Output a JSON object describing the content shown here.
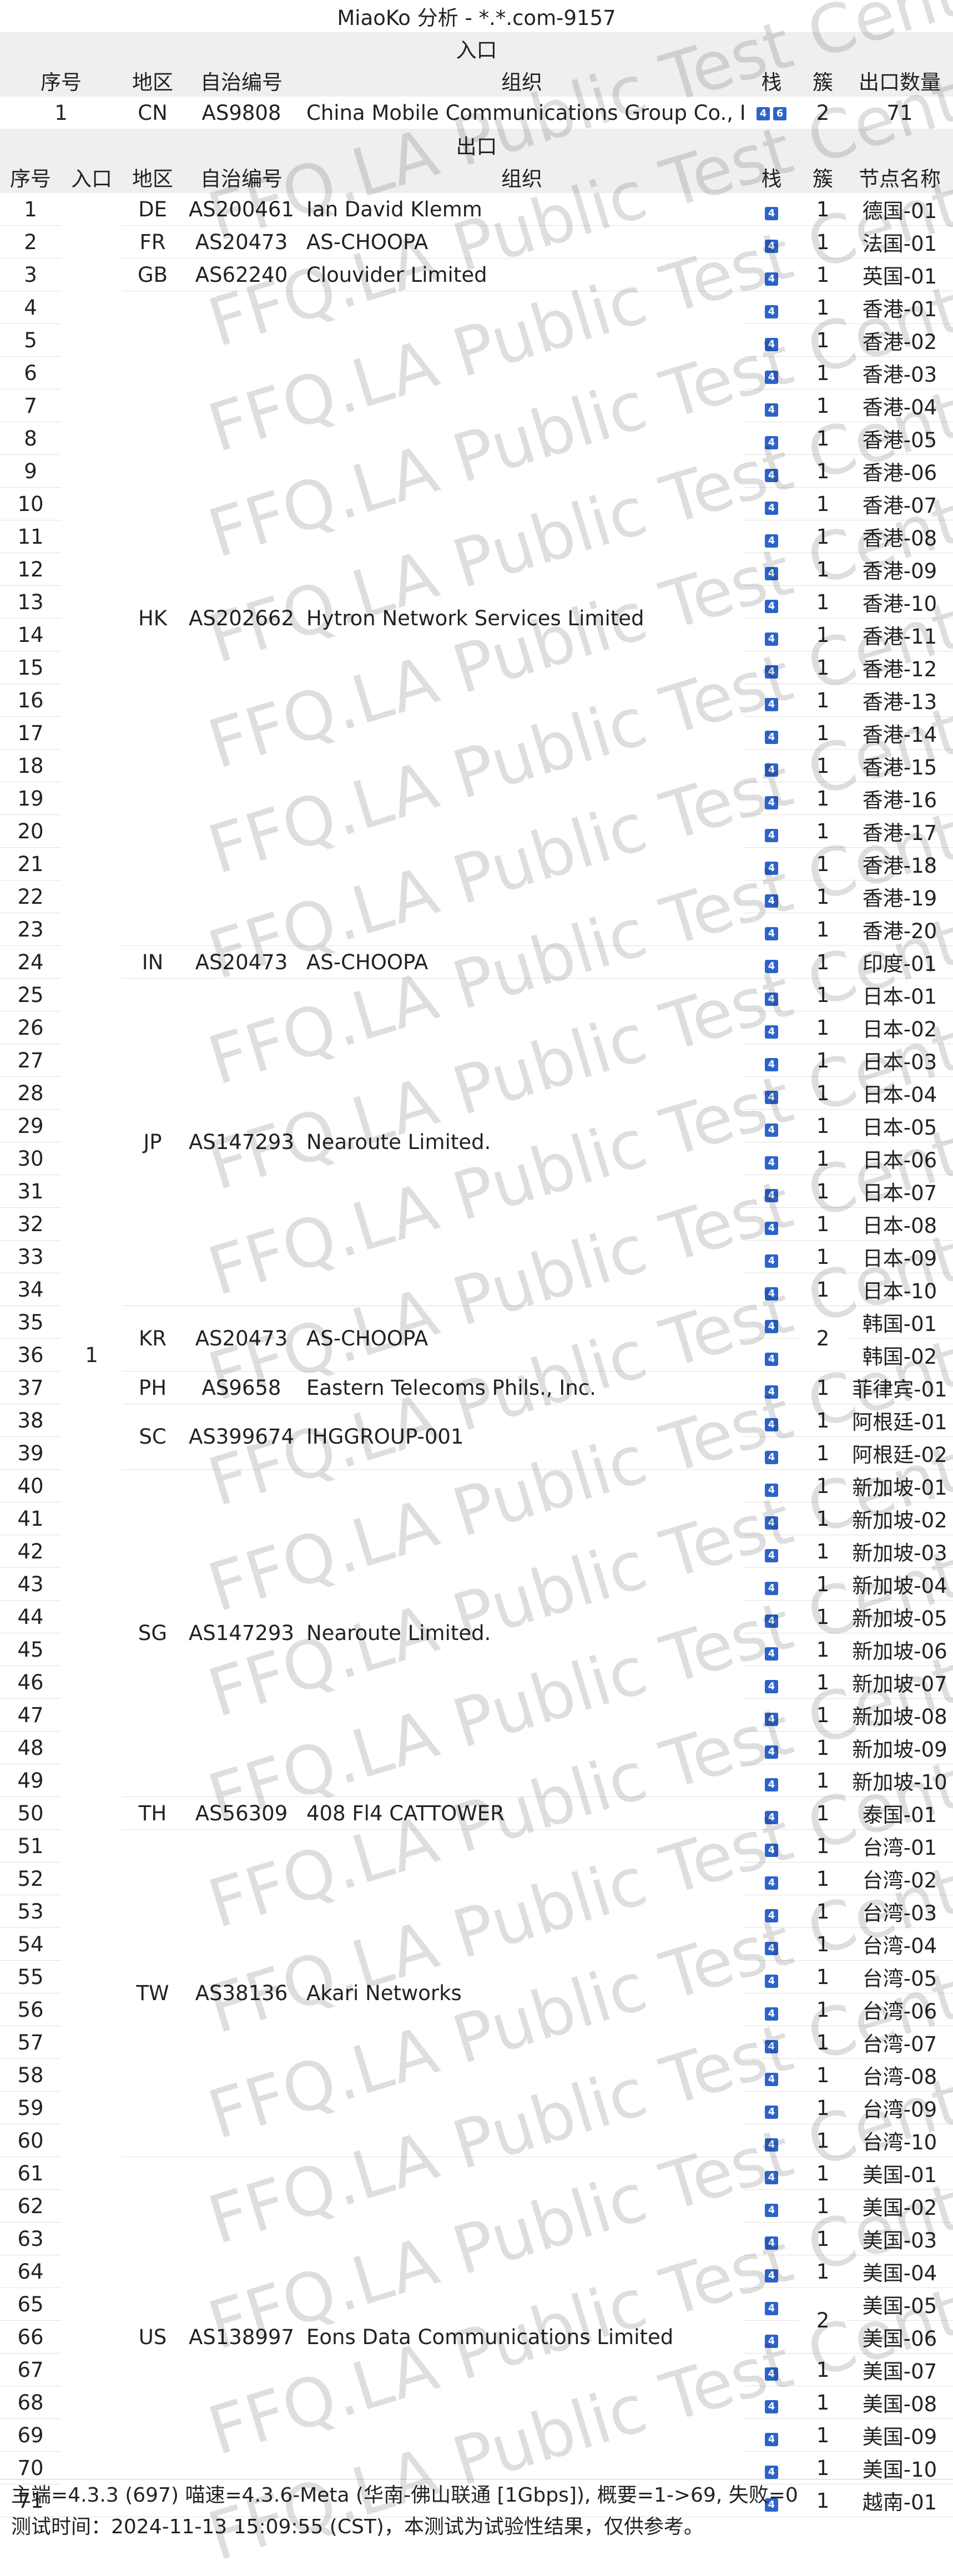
{
  "title": "MiaoKo 分析 - *.*.com-9157",
  "inbound": {
    "section_label": "入口",
    "headers": [
      "序号",
      "地区",
      "自治编号",
      "组织",
      "栈",
      "簇",
      "出口数量"
    ],
    "rows": [
      {
        "idx": "1",
        "region": "CN",
        "asn": "AS9808",
        "org": "China Mobile Communications Group Co., Ltd.",
        "stack": [
          "4",
          "6"
        ],
        "cluster": "2",
        "count": "71"
      }
    ]
  },
  "outbound": {
    "section_label": "出口",
    "headers": [
      "序号",
      "入口",
      "地区",
      "自治编号",
      "组织",
      "栈",
      "簇",
      "节点名称"
    ],
    "entry_value": "1",
    "groups": [
      {
        "region": "DE",
        "asn": "AS200461",
        "org": "Ian David Klemm",
        "nodes": [
          {
            "idx": "1",
            "name": "德国-01"
          }
        ],
        "clusters": [
          {
            "value": "1",
            "span": 1
          }
        ]
      },
      {
        "region": "FR",
        "asn": "AS20473",
        "org": "AS-CHOOPA",
        "nodes": [
          {
            "idx": "2",
            "name": "法国-01"
          }
        ],
        "clusters": [
          {
            "value": "1",
            "span": 1
          }
        ]
      },
      {
        "region": "GB",
        "asn": "AS62240",
        "org": "Clouvider Limited",
        "nodes": [
          {
            "idx": "3",
            "name": "英国-01"
          }
        ],
        "clusters": [
          {
            "value": "1",
            "span": 1
          }
        ]
      },
      {
        "region": "HK",
        "asn": "AS202662",
        "org": "Hytron Network Services Limited",
        "nodes": [
          {
            "idx": "4",
            "name": "香港-01"
          },
          {
            "idx": "5",
            "name": "香港-02"
          },
          {
            "idx": "6",
            "name": "香港-03"
          },
          {
            "idx": "7",
            "name": "香港-04"
          },
          {
            "idx": "8",
            "name": "香港-05"
          },
          {
            "idx": "9",
            "name": "香港-06"
          },
          {
            "idx": "10",
            "name": "香港-07"
          },
          {
            "idx": "11",
            "name": "香港-08"
          },
          {
            "idx": "12",
            "name": "香港-09"
          },
          {
            "idx": "13",
            "name": "香港-10"
          },
          {
            "idx": "14",
            "name": "香港-11"
          },
          {
            "idx": "15",
            "name": "香港-12"
          },
          {
            "idx": "16",
            "name": "香港-13"
          },
          {
            "idx": "17",
            "name": "香港-14"
          },
          {
            "idx": "18",
            "name": "香港-15"
          },
          {
            "idx": "19",
            "name": "香港-16"
          },
          {
            "idx": "20",
            "name": "香港-17"
          },
          {
            "idx": "21",
            "name": "香港-18"
          },
          {
            "idx": "22",
            "name": "香港-19"
          },
          {
            "idx": "23",
            "name": "香港-20"
          }
        ],
        "clusters": [
          {
            "value": "1",
            "span": 1
          },
          {
            "value": "1",
            "span": 1
          },
          {
            "value": "1",
            "span": 1
          },
          {
            "value": "1",
            "span": 1
          },
          {
            "value": "1",
            "span": 1
          },
          {
            "value": "1",
            "span": 1
          },
          {
            "value": "1",
            "span": 1
          },
          {
            "value": "1",
            "span": 1
          },
          {
            "value": "1",
            "span": 1
          },
          {
            "value": "1",
            "span": 1
          },
          {
            "value": "1",
            "span": 1
          },
          {
            "value": "1",
            "span": 1
          },
          {
            "value": "1",
            "span": 1
          },
          {
            "value": "1",
            "span": 1
          },
          {
            "value": "1",
            "span": 1
          },
          {
            "value": "1",
            "span": 1
          },
          {
            "value": "1",
            "span": 1
          },
          {
            "value": "1",
            "span": 1
          },
          {
            "value": "1",
            "span": 1
          },
          {
            "value": "1",
            "span": 1
          }
        ]
      },
      {
        "region": "IN",
        "asn": "AS20473",
        "org": "AS-CHOOPA",
        "nodes": [
          {
            "idx": "24",
            "name": "印度-01"
          }
        ],
        "clusters": [
          {
            "value": "1",
            "span": 1
          }
        ]
      },
      {
        "region": "JP",
        "asn": "AS147293",
        "org": "Nearoute Limited.",
        "nodes": [
          {
            "idx": "25",
            "name": "日本-01"
          },
          {
            "idx": "26",
            "name": "日本-02"
          },
          {
            "idx": "27",
            "name": "日本-03"
          },
          {
            "idx": "28",
            "name": "日本-04"
          },
          {
            "idx": "29",
            "name": "日本-05"
          },
          {
            "idx": "30",
            "name": "日本-06"
          },
          {
            "idx": "31",
            "name": "日本-07"
          },
          {
            "idx": "32",
            "name": "日本-08"
          },
          {
            "idx": "33",
            "name": "日本-09"
          },
          {
            "idx": "34",
            "name": "日本-10"
          }
        ],
        "clusters": [
          {
            "value": "1",
            "span": 1
          },
          {
            "value": "1",
            "span": 1
          },
          {
            "value": "1",
            "span": 1
          },
          {
            "value": "1",
            "span": 1
          },
          {
            "value": "1",
            "span": 1
          },
          {
            "value": "1",
            "span": 1
          },
          {
            "value": "1",
            "span": 1
          },
          {
            "value": "1",
            "span": 1
          },
          {
            "value": "1",
            "span": 1
          },
          {
            "value": "1",
            "span": 1
          }
        ]
      },
      {
        "region": "KR",
        "asn": "AS20473",
        "org": "AS-CHOOPA",
        "nodes": [
          {
            "idx": "35",
            "name": "韩国-01"
          },
          {
            "idx": "36",
            "name": "韩国-02"
          }
        ],
        "clusters": [
          {
            "value": "2",
            "span": 2
          }
        ]
      },
      {
        "region": "PH",
        "asn": "AS9658",
        "org": "Eastern Telecoms Phils., Inc.",
        "nodes": [
          {
            "idx": "37",
            "name": "菲律宾-01"
          }
        ],
        "clusters": [
          {
            "value": "1",
            "span": 1
          }
        ]
      },
      {
        "region": "SC",
        "asn": "AS399674",
        "org": "IHGGROUP-001",
        "nodes": [
          {
            "idx": "38",
            "name": "阿根廷-01"
          },
          {
            "idx": "39",
            "name": "阿根廷-02"
          }
        ],
        "clusters": [
          {
            "value": "1",
            "span": 1
          },
          {
            "value": "1",
            "span": 1
          }
        ]
      },
      {
        "region": "SG",
        "asn": "AS147293",
        "org": "Nearoute Limited.",
        "nodes": [
          {
            "idx": "40",
            "name": "新加坡-01"
          },
          {
            "idx": "41",
            "name": "新加坡-02"
          },
          {
            "idx": "42",
            "name": "新加坡-03"
          },
          {
            "idx": "43",
            "name": "新加坡-04"
          },
          {
            "idx": "44",
            "name": "新加坡-05"
          },
          {
            "idx": "45",
            "name": "新加坡-06"
          },
          {
            "idx": "46",
            "name": "新加坡-07"
          },
          {
            "idx": "47",
            "name": "新加坡-08"
          },
          {
            "idx": "48",
            "name": "新加坡-09"
          },
          {
            "idx": "49",
            "name": "新加坡-10"
          }
        ],
        "clusters": [
          {
            "value": "1",
            "span": 1
          },
          {
            "value": "1",
            "span": 1
          },
          {
            "value": "1",
            "span": 1
          },
          {
            "value": "1",
            "span": 1
          },
          {
            "value": "1",
            "span": 1
          },
          {
            "value": "1",
            "span": 1
          },
          {
            "value": "1",
            "span": 1
          },
          {
            "value": "1",
            "span": 1
          },
          {
            "value": "1",
            "span": 1
          },
          {
            "value": "1",
            "span": 1
          }
        ]
      },
      {
        "region": "TH",
        "asn": "AS56309",
        "org": "408 Fl4 CATTOWER",
        "nodes": [
          {
            "idx": "50",
            "name": "泰国-01"
          }
        ],
        "clusters": [
          {
            "value": "1",
            "span": 1
          }
        ]
      },
      {
        "region": "TW",
        "asn": "AS38136",
        "org": "Akari Networks",
        "nodes": [
          {
            "idx": "51",
            "name": "台湾-01"
          },
          {
            "idx": "52",
            "name": "台湾-02"
          },
          {
            "idx": "53",
            "name": "台湾-03"
          },
          {
            "idx": "54",
            "name": "台湾-04"
          },
          {
            "idx": "55",
            "name": "台湾-05"
          },
          {
            "idx": "56",
            "name": "台湾-06"
          },
          {
            "idx": "57",
            "name": "台湾-07"
          },
          {
            "idx": "58",
            "name": "台湾-08"
          },
          {
            "idx": "59",
            "name": "台湾-09"
          },
          {
            "idx": "60",
            "name": "台湾-10"
          }
        ],
        "clusters": [
          {
            "value": "1",
            "span": 1
          },
          {
            "value": "1",
            "span": 1
          },
          {
            "value": "1",
            "span": 1
          },
          {
            "value": "1",
            "span": 1
          },
          {
            "value": "1",
            "span": 1
          },
          {
            "value": "1",
            "span": 1
          },
          {
            "value": "1",
            "span": 1
          },
          {
            "value": "1",
            "span": 1
          },
          {
            "value": "1",
            "span": 1
          },
          {
            "value": "1",
            "span": 1
          }
        ]
      },
      {
        "region": "US",
        "asn": "AS138997",
        "org": "Eons Data Communications Limited",
        "nodes": [
          {
            "idx": "61",
            "name": "美国-01"
          },
          {
            "idx": "62",
            "name": "美国-02"
          },
          {
            "idx": "63",
            "name": "美国-03"
          },
          {
            "idx": "64",
            "name": "美国-04"
          },
          {
            "idx": "65",
            "name": "美国-05"
          },
          {
            "idx": "66",
            "name": "美国-06"
          },
          {
            "idx": "67",
            "name": "美国-07"
          },
          {
            "idx": "68",
            "name": "美国-08"
          },
          {
            "idx": "69",
            "name": "美国-09"
          },
          {
            "idx": "70",
            "name": "美国-10"
          },
          {
            "idx": "71",
            "name": "越南-01"
          }
        ],
        "clusters": [
          {
            "value": "1",
            "span": 1
          },
          {
            "value": "1",
            "span": 1
          },
          {
            "value": "1",
            "span": 1
          },
          {
            "value": "1",
            "span": 1
          },
          {
            "value": "2",
            "span": 2
          },
          {
            "value": "1",
            "span": 1
          },
          {
            "value": "1",
            "span": 1
          },
          {
            "value": "1",
            "span": 1
          },
          {
            "value": "1",
            "span": 1
          },
          {
            "value": "1",
            "span": 1
          }
        ]
      }
    ],
    "stack_badge": "4"
  },
  "footer": {
    "line1": "主端=4.3.3 (697) 喵速=4.3.6-Meta (华南-佛山联通 [1Gbps]), 概要=1->69, 失败=0",
    "line2": "测试时间：2024-11-13 15:09:55 (CST)，本测试为试验性结果，仅供参考。"
  },
  "watermark": "FFQ.LA Public Test Center",
  "colors": {
    "badge": "#2c63c9",
    "header_bg": "#efefef"
  }
}
